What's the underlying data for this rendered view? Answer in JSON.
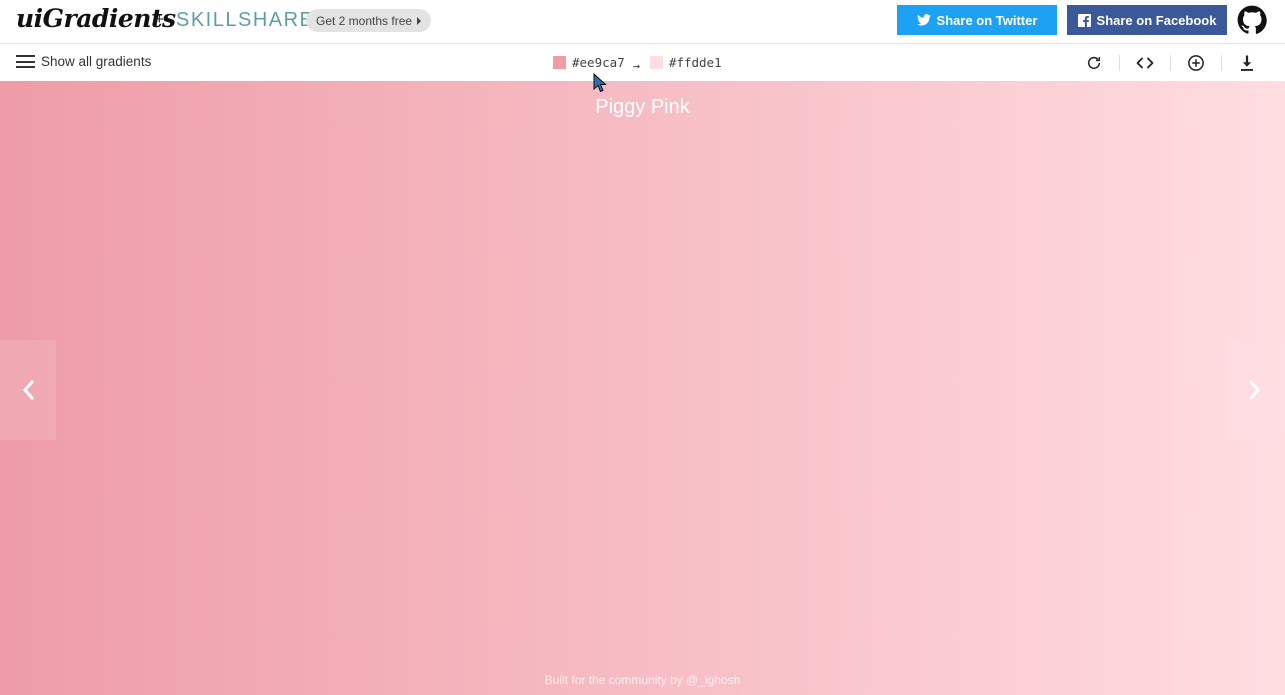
{
  "header": {
    "logo": "uiGradients",
    "plus": "+",
    "partner": "SKILLSHARE",
    "promo_label": "Get 2 months free",
    "twitter_label": "Share on Twitter",
    "facebook_label": "Share on Facebook"
  },
  "toolbar": {
    "menu_label": "Show all gradients",
    "color_from": "#ee9ca7",
    "color_to": "#ffdde1",
    "arrow": "→"
  },
  "gradient": {
    "name": "Piggy Pink",
    "start": "#ee9ca7",
    "end": "#ffdde1"
  },
  "footer": {
    "text": "Built for the community by @_ighosh"
  },
  "colors": {
    "twitter": "#1da1f2",
    "facebook": "#3b5998",
    "skillshare": "#5f9ea7"
  }
}
